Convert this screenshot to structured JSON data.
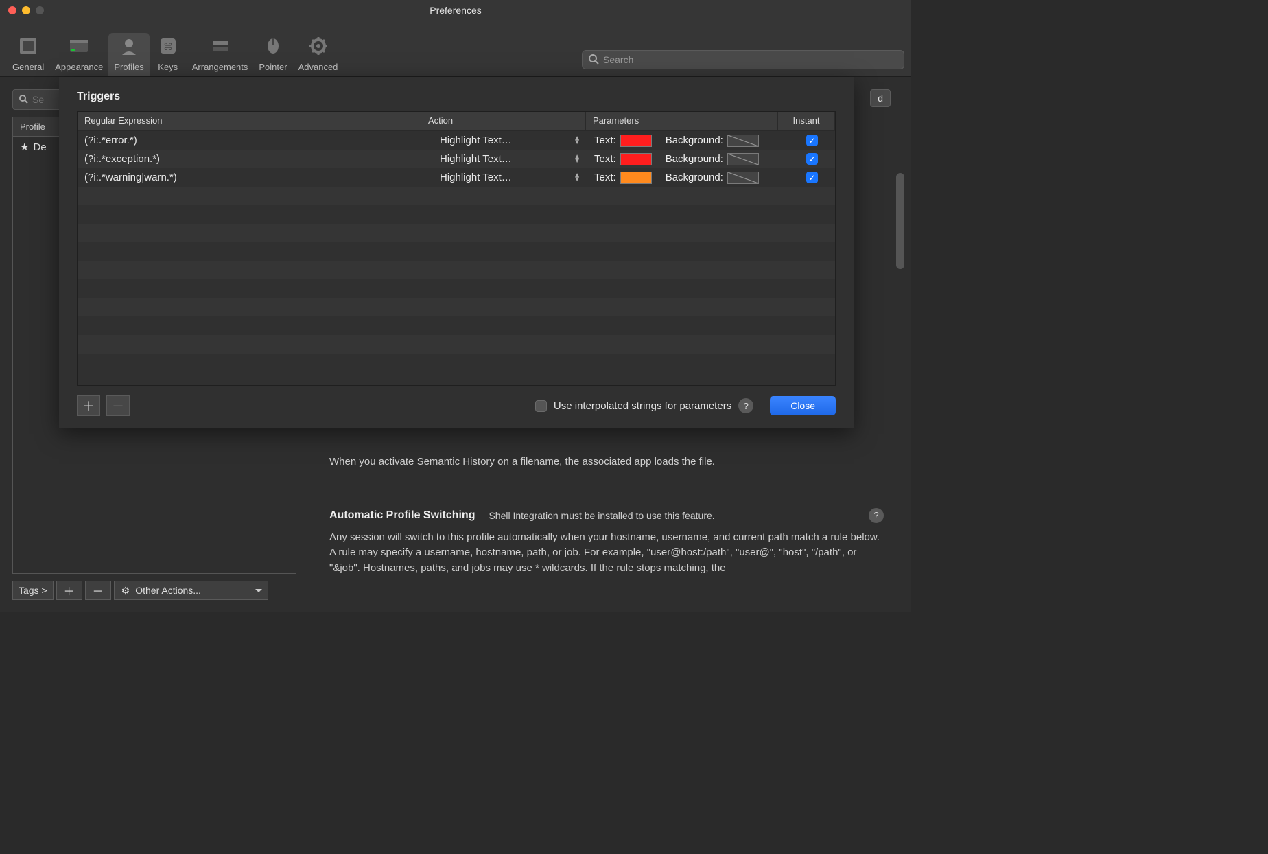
{
  "window": {
    "title": "Preferences"
  },
  "toolbar": {
    "items": [
      {
        "id": "general",
        "label": "General"
      },
      {
        "id": "appearance",
        "label": "Appearance"
      },
      {
        "id": "profiles",
        "label": "Profiles"
      },
      {
        "id": "keys",
        "label": "Keys"
      },
      {
        "id": "arrangements",
        "label": "Arrangements"
      },
      {
        "id": "pointer",
        "label": "Pointer"
      },
      {
        "id": "advanced",
        "label": "Advanced"
      }
    ],
    "search_placeholder": "Search"
  },
  "sidebar": {
    "search_placeholder": "Se",
    "header": "Profile",
    "items": [
      {
        "label": "De"
      }
    ],
    "tags_label": "Tags >",
    "other_actions_label": "Other Actions..."
  },
  "content": {
    "tab_fragment_text": "d",
    "semantic_history_desc": "When you activate Semantic History on a filename, the associated app loads the file.",
    "aps_title": "Automatic Profile Switching",
    "aps_note": "Shell Integration must be installed to use this feature.",
    "aps_desc": "Any session will switch to this profile automatically when your hostname, username, and current path match a rule below. A rule may specify a username, hostname, path, or job. For example, \"user@host:/path\", \"user@\", \"host\", \"/path\", or \"&job\". Hostnames, paths, and jobs may use * wildcards. If the rule stops matching, the"
  },
  "dialog": {
    "title": "Triggers",
    "columns": {
      "regex": "Regular Expression",
      "action": "Action",
      "params": "Parameters",
      "instant": "Instant"
    },
    "param_labels": {
      "text": "Text:",
      "background": "Background:"
    },
    "rows": [
      {
        "regex": "(?i:.*error.*)",
        "action": "Highlight Text…",
        "text_color": "#ff1e1e",
        "bg_none": true,
        "instant": true
      },
      {
        "regex": "(?i:.*exception.*)",
        "action": "Highlight Text…",
        "text_color": "#ff1e1e",
        "bg_none": true,
        "instant": true
      },
      {
        "regex": "(?i:.*warning|warn.*)",
        "action": "Highlight Text…",
        "text_color": "#ff8a1e",
        "bg_none": true,
        "instant": true
      }
    ],
    "interpolated_label": "Use interpolated strings for parameters",
    "close_label": "Close"
  },
  "colors": {
    "accent": "#1976ff"
  }
}
